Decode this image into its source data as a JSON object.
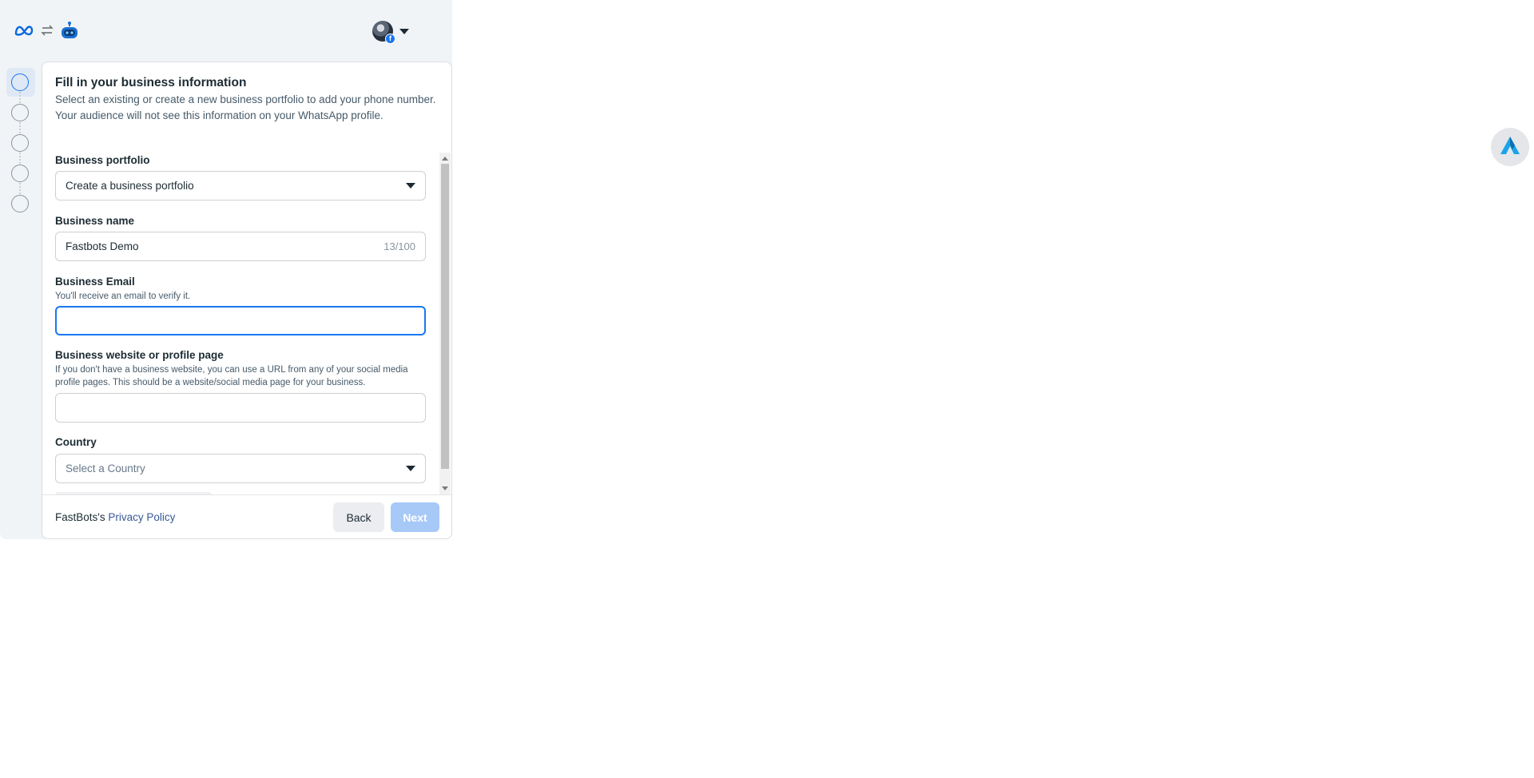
{
  "header": {
    "meta_logo": "meta-logo-icon",
    "swap_icon": "swap-arrows-icon",
    "bot_icon": "robot-icon"
  },
  "account": {
    "avatar": "account-avatar",
    "menu_icon": "caret-down-icon"
  },
  "steps": [
    {
      "state": "active"
    },
    {
      "state": "pending"
    },
    {
      "state": "pending"
    },
    {
      "state": "pending"
    },
    {
      "state": "pending"
    }
  ],
  "form": {
    "title": "Fill in your business information",
    "description": "Select an existing or create a new business portfolio to add your phone number. Your audience will not see this information on your WhatsApp profile.",
    "portfolio": {
      "label": "Business portfolio",
      "value": "Create a business portfolio"
    },
    "business_name": {
      "label": "Business name",
      "value": "Fastbots Demo",
      "counter": "13/100"
    },
    "email": {
      "label": "Business Email",
      "help": "You'll receive an email to verify it.",
      "value": ""
    },
    "website": {
      "label": "Business website or profile page",
      "help": "If you don't have a business website, you can use a URL from any of your social media profile pages. This should be a website/social media page for your business.",
      "value": ""
    },
    "country": {
      "label": "Country",
      "placeholder": "Select a Country"
    }
  },
  "footer": {
    "policy_prefix": "FastBots's ",
    "policy_link": "Privacy Policy",
    "back_label": "Back",
    "next_label": "Next"
  },
  "colors": {
    "accent": "#1877f2",
    "next_disabled": "#a7c9f7",
    "link": "#385898"
  }
}
